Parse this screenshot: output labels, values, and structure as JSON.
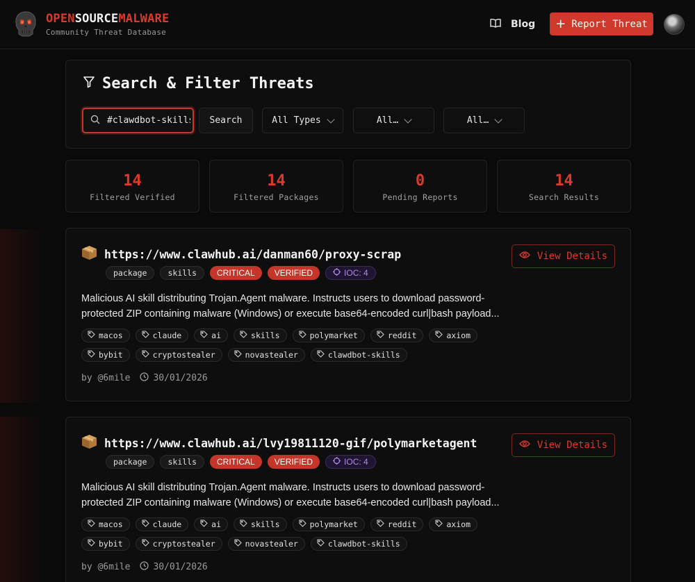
{
  "header": {
    "brand_red_1": "OPEN",
    "brand_white": "SOURCE",
    "brand_red_2": "MALWARE",
    "subtitle": "Community Threat Database",
    "blog_label": "Blog",
    "report_label": "Report Threat"
  },
  "search": {
    "title": "Search & Filter Threats",
    "input_value": "#clawdbot-skills",
    "search_label": "Search",
    "filter_type": "All Types",
    "filter_2": "All…",
    "filter_3": "All…"
  },
  "stats": [
    {
      "value": "14",
      "label": "Filtered Verified"
    },
    {
      "value": "14",
      "label": "Filtered Packages"
    },
    {
      "value": "0",
      "label": "Pending Reports"
    },
    {
      "value": "14",
      "label": "Search Results"
    }
  ],
  "threats": [
    {
      "url": "https://www.clawhub.ai/danman60/proxy-scrap",
      "badges": {
        "type": "package",
        "category": "skills",
        "severity": "CRITICAL",
        "status": "VERIFIED",
        "ioc": "IOC: 4"
      },
      "view_label": "View Details",
      "description": "Malicious AI skill distributing Trojan.Agent malware. Instructs users to download password-protected ZIP containing malware (Windows) or execute base64-encoded curl|bash payload...",
      "tags": [
        "macos",
        "claude",
        "ai",
        "skills",
        "polymarket",
        "reddit",
        "axiom",
        "bybit",
        "cryptostealer",
        "novastealer",
        "clawdbot-skills"
      ],
      "author": "by @6mile",
      "date": "30/01/2026"
    },
    {
      "url": "https://www.clawhub.ai/lvy19811120-gif/polymarketagent",
      "badges": {
        "type": "package",
        "category": "skills",
        "severity": "CRITICAL",
        "status": "VERIFIED",
        "ioc": "IOC: 4"
      },
      "view_label": "View Details",
      "description": "Malicious AI skill distributing Trojan.Agent malware. Instructs users to download password-protected ZIP containing malware (Windows) or execute base64-encoded curl|bash payload...",
      "tags": [
        "macos",
        "claude",
        "ai",
        "skills",
        "polymarket",
        "reddit",
        "axiom",
        "bybit",
        "cryptostealer",
        "novastealer",
        "clawdbot-skills"
      ],
      "author": "by @6mile",
      "date": "30/01/2026"
    }
  ],
  "colors": {
    "accent": "#d0382b",
    "background": "#0a0a0a",
    "panel": "#0e0e0e",
    "ioc": "#b08ae8"
  },
  "icons": [
    "skull-logo-icon",
    "book-icon",
    "plus-icon",
    "filter-icon",
    "search-icon",
    "chevron-down-icon",
    "package-icon",
    "eye-icon",
    "tag-icon",
    "clock-icon",
    "ioc-target-icon"
  ]
}
